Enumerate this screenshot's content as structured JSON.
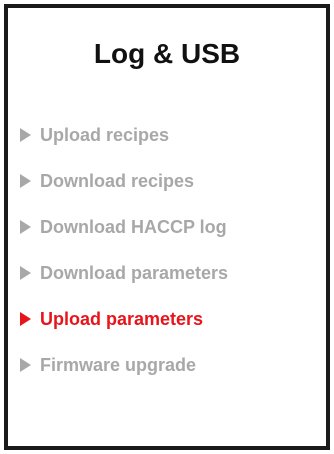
{
  "panel": {
    "title": "Log & USB"
  },
  "colors": {
    "inactive": "#a8a8a8",
    "active": "#e8141c",
    "border": "#1a1a1a"
  },
  "menu": {
    "items": [
      {
        "label": "Upload recipes",
        "icon": "triangle-right-icon",
        "selected": false
      },
      {
        "label": "Download recipes",
        "icon": "triangle-right-icon",
        "selected": false
      },
      {
        "label": "Download HACCP log",
        "icon": "triangle-right-icon",
        "selected": false
      },
      {
        "label": "Download parameters",
        "icon": "triangle-right-icon",
        "selected": false
      },
      {
        "label": "Upload parameters",
        "icon": "triangle-right-icon",
        "selected": true
      },
      {
        "label": "Firmware upgrade",
        "icon": "triangle-right-icon",
        "selected": false
      }
    ]
  }
}
